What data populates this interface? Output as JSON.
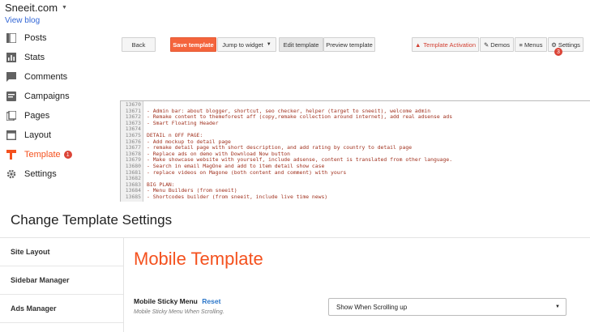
{
  "blog": {
    "title": "Sneeit.com",
    "view_blog": "View blog"
  },
  "nav": [
    {
      "label": "Posts",
      "icon": "posts-icon"
    },
    {
      "label": "Stats",
      "icon": "stats-icon"
    },
    {
      "label": "Comments",
      "icon": "comments-icon"
    },
    {
      "label": "Campaigns",
      "icon": "campaigns-icon"
    },
    {
      "label": "Pages",
      "icon": "pages-icon"
    },
    {
      "label": "Layout",
      "icon": "layout-icon"
    },
    {
      "label": "Template",
      "icon": "template-icon",
      "badge": "1",
      "active": true
    },
    {
      "label": "Settings",
      "icon": "settings-icon"
    }
  ],
  "toolbar": {
    "back": "Back",
    "save": "Save template",
    "jump": "Jump to widget",
    "edit": "Edit template",
    "preview": "Preview template",
    "activation": "Template Activation",
    "demos": "Demos",
    "menus": "Menus",
    "settings": "Settings",
    "settings_badge": "3"
  },
  "editor": {
    "line_numbers": [
      "13670",
      "13671",
      "13672",
      "13673",
      "13674",
      "13675",
      "13676",
      "13677",
      "13678",
      "13679",
      "13680",
      "13681",
      "13682",
      "13683",
      "13684",
      "13685"
    ],
    "lines": [
      "",
      "- Admin bar: about blogger, shortcut, seo checker, helper (target to sneeit), welcome admin",
      "- Remake content to themeforest aff (copy,remake collection around internet), add real adsense ads",
      "- Smart Floating Header",
      "",
      "DETAIL n OFF PAGE:",
      "- Add mockup to detail page",
      "- remake detail page with short description, and add rating by country to detail page",
      "- Replace ads on demo with Download Now button",
      "- Make showcase website with yourself, include adsense, content is translated from other language.",
      "- Search in email MagOne and add to item detail show case",
      "- replace videos on Magone (both content and comment) with yours",
      "",
      "BIG PLAN:",
      "- Menu Builders (from sneeit)",
      "- Shortcodes builder (from sneeit, include live time news)"
    ]
  },
  "settings": {
    "title": "Change Template Settings",
    "menu": [
      "Site Layout",
      "Sidebar Manager",
      "Ads Manager"
    ],
    "section_title": "Mobile Template",
    "option_label": "Mobile Sticky Menu",
    "option_reset": "Reset",
    "option_help": "Mobile Sticky Menu When Scrolling.",
    "option_value": "Show When Scrolling up"
  },
  "colors": {
    "accent": "#f4511e",
    "primary_button": "#f4643c",
    "badge": "#db4437",
    "link": "#3367d6"
  }
}
